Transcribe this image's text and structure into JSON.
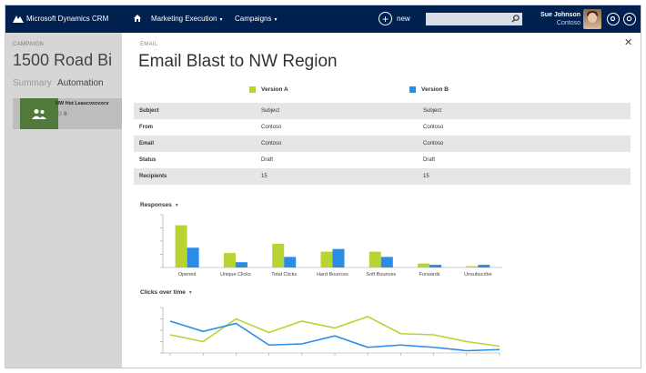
{
  "topnav": {
    "app_name": "Microsoft Dynamics CRM",
    "nav_marketing": "Marketing Execution",
    "nav_campaigns": "Campaigns",
    "new_label": "new",
    "user_name": "Sue Johnson",
    "user_org": "Contoso"
  },
  "left": {
    "caption": "CAMPAIGN",
    "record_name": "1500 Road Bi",
    "tab_summary": "Summary",
    "tab_automation": "Automation",
    "tile_title": "NW Hot Leascvxcvxcv",
    "tile_count": "8"
  },
  "main": {
    "caption": "EMAIL",
    "title": "Email Blast to NW Region",
    "version_a": "Version A",
    "version_b": "Version B",
    "color_a": "#b8d432",
    "color_b": "#2b8ce6",
    "rows": [
      {
        "label": "Subject",
        "a": "Subject",
        "b": "Subject"
      },
      {
        "label": "From",
        "a": "Contoso",
        "b": "Contoso"
      },
      {
        "label": "Email",
        "a": "Contoso",
        "b": "Contoso"
      },
      {
        "label": "Status",
        "a": "Draft",
        "b": "Draft"
      },
      {
        "label": "Recipients",
        "a": "15",
        "b": "15"
      }
    ],
    "responses_label": "Responses",
    "clicks_label": "Clicks over time"
  },
  "chart_data": [
    {
      "type": "bar",
      "categories": [
        "Opened",
        "Unique Clicks",
        "Total Clicks",
        "Hard Bounces",
        "Soft Bounces",
        "Forwards",
        "Unsubscribe"
      ],
      "series": [
        {
          "name": "Version A",
          "values": [
            32,
            11,
            18,
            12,
            12,
            3,
            1
          ]
        },
        {
          "name": "Version B",
          "values": [
            15,
            4,
            8,
            14,
            8,
            2,
            2
          ]
        }
      ],
      "ylim": [
        0,
        40
      ],
      "grid": false
    },
    {
      "type": "line",
      "x": [
        1,
        2,
        3,
        4,
        5,
        6,
        7,
        8,
        9,
        10,
        11
      ],
      "series": [
        {
          "name": "Version A",
          "values": [
            16,
            10,
            30,
            18,
            28,
            22,
            32,
            17,
            16,
            10,
            6
          ]
        },
        {
          "name": "Version B",
          "values": [
            28,
            19,
            26,
            7,
            8,
            15,
            5,
            7,
            5,
            2,
            3
          ]
        }
      ],
      "ylim": [
        0,
        40
      ],
      "grid": false
    }
  ]
}
